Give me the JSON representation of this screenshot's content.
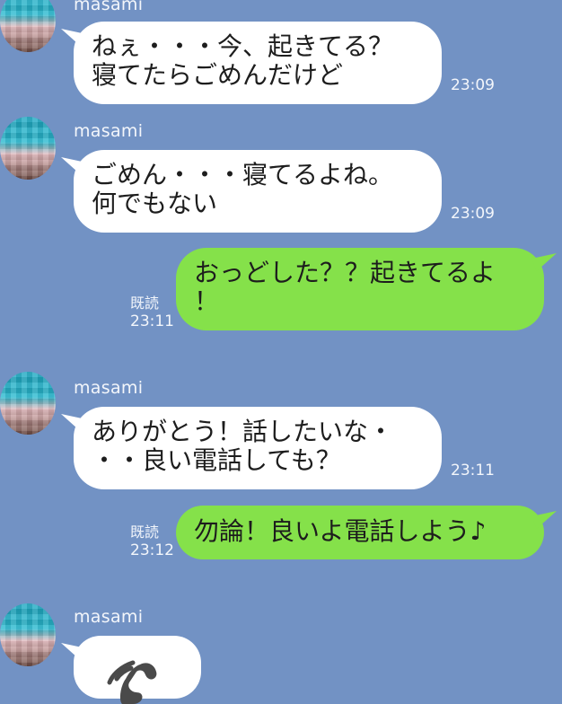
{
  "messages": [
    {
      "sender": "masami",
      "text": "ねぇ・・・今、起きてる？\n寝てたらごめんだけど",
      "time": "23:09"
    },
    {
      "sender": "masami",
      "text": "ごめん・・・寝てるよね。\n何でもない",
      "time": "23:09"
    },
    {
      "sender": "me",
      "text": "おっどした？？起きてるよ\n！",
      "read_label": "既読",
      "time": "23:11"
    },
    {
      "sender": "masami",
      "text": "ありがとう！話したいな・\n・・良い電話しても？",
      "time": "23:11"
    },
    {
      "sender": "me",
      "text": "勿論！良いよ電話しよう♪",
      "read_label": "既読",
      "time": "23:12"
    },
    {
      "sender": "masami",
      "type": "call",
      "icon": "phone-icon"
    }
  ],
  "colors": {
    "background": "#7292c4",
    "incoming_bubble": "#ffffff",
    "outgoing_bubble": "#85e14a"
  }
}
